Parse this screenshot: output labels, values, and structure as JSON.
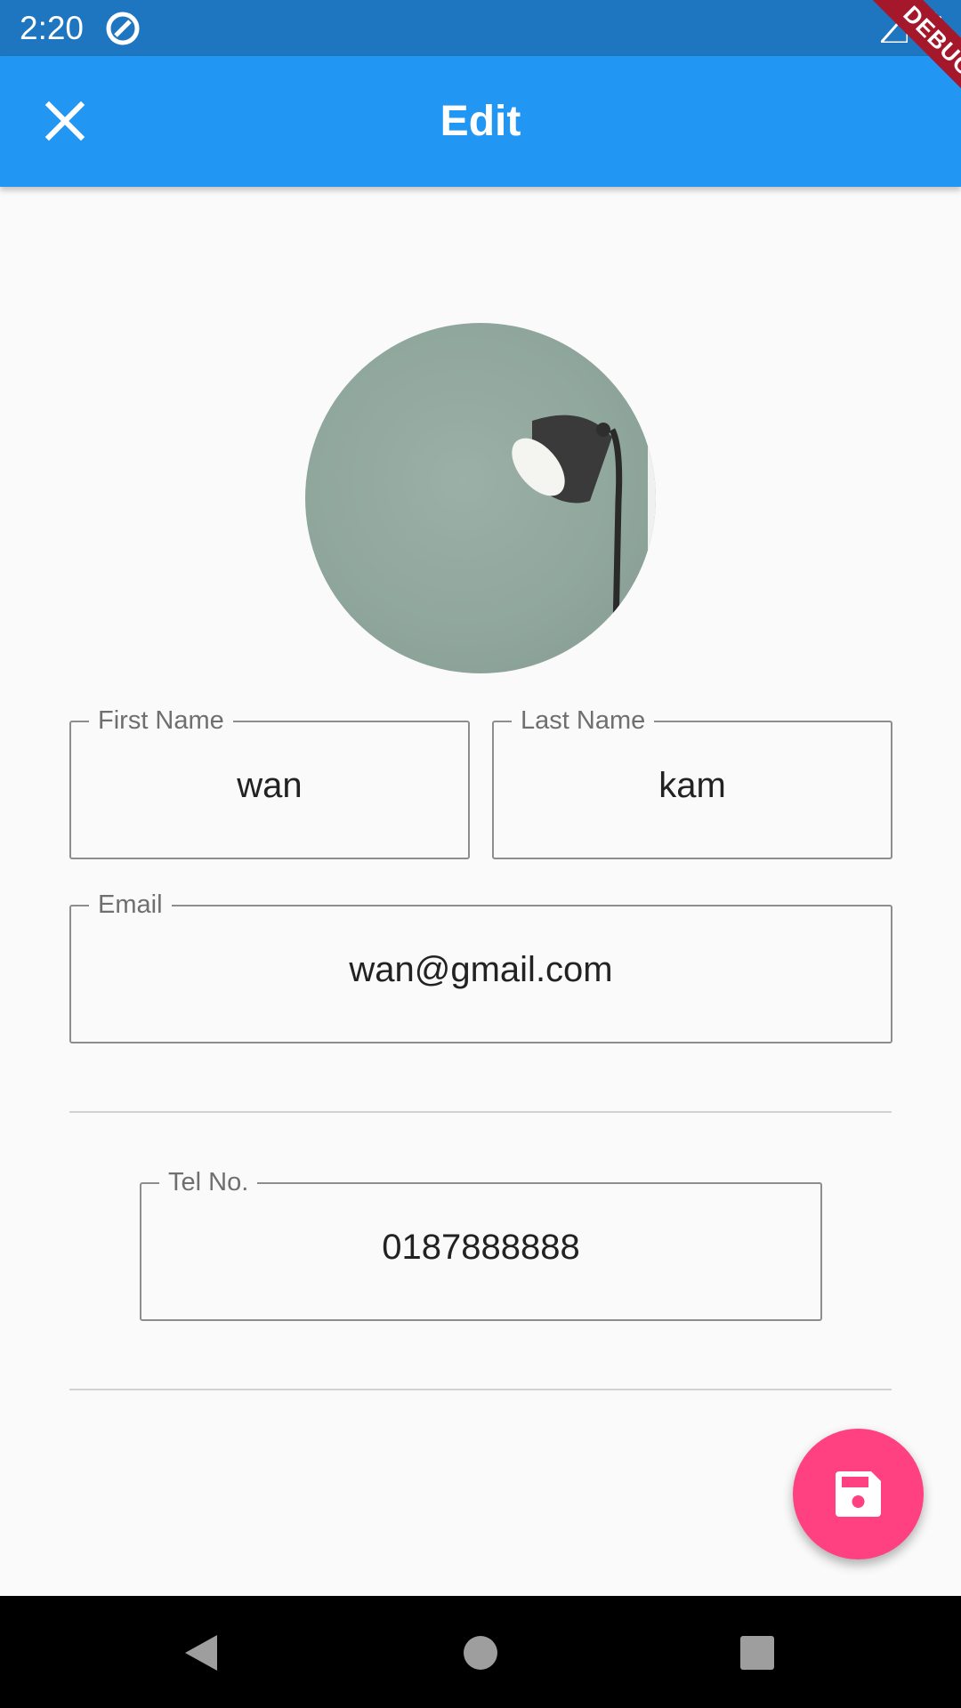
{
  "status_bar": {
    "time": "2:20",
    "icons": [
      "app-notification-icon",
      "signal-icon",
      "battery-icon"
    ]
  },
  "debug_banner": {
    "label": "DEBUG"
  },
  "app_bar": {
    "title": "Edit",
    "leading_icon": "close-icon",
    "color": "#2196f3"
  },
  "form": {
    "avatar": {
      "description_icon": "avatar"
    },
    "first_name": {
      "label": "First Name",
      "value": "wan"
    },
    "last_name": {
      "label": "Last Name",
      "value": "kam"
    },
    "email": {
      "label": "Email",
      "value": "wan@gmail.com"
    },
    "tel": {
      "label": "Tel No.",
      "value": "0187888888"
    }
  },
  "fab": {
    "icon": "save-icon",
    "color": "#ff4081"
  },
  "nav_bar": {
    "icons": [
      "back-icon",
      "home-icon",
      "recents-icon"
    ]
  }
}
